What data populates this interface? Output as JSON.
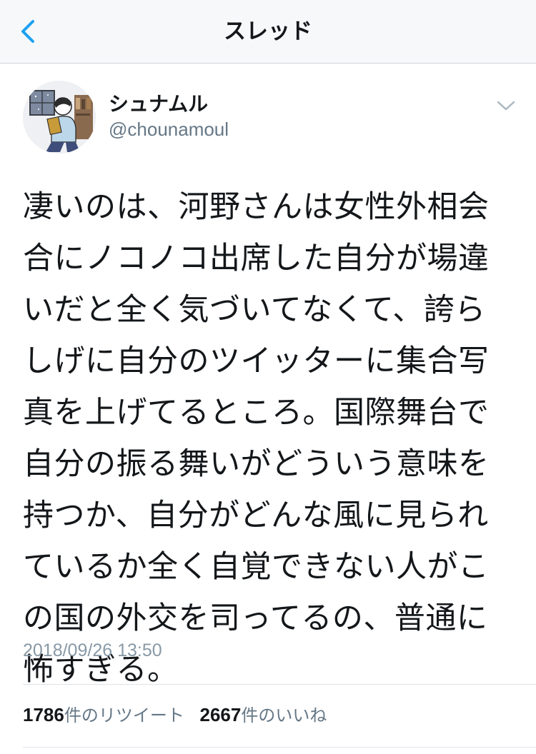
{
  "header": {
    "title": "スレッド",
    "back_icon": "chevron-left-icon"
  },
  "author": {
    "display_name": "シュナムル",
    "handle": "@chounamoul",
    "avatar": "avatar-illustration-person-reading"
  },
  "tweet": {
    "lines": [
      "凄いのは、河野さんは女性外相会",
      "合にノコノコ出席した自分が場違",
      "いだと全く気づいてなくて、誇ら",
      "しげに自分のツイッターに集合写",
      "真を上げてるところ。国際舞台で",
      "自分の振る舞いがどういう意味を",
      "持つか、自分がどんな風に見られ",
      "ているか全く自覚できない人がこ",
      "の国の外交を司ってるの、普通に",
      "怖すぎる。"
    ],
    "timestamp": "2018/09/26 13:50"
  },
  "stats": {
    "retweets_count": "1786",
    "retweets_label": "件のリツイート",
    "likes_count": "2667",
    "likes_label": "件のいいね"
  },
  "colors": {
    "accent": "#1da1f2",
    "text_primary": "#14171a",
    "text_secondary": "#657786",
    "navbar_bg": "#f7f8fa"
  }
}
